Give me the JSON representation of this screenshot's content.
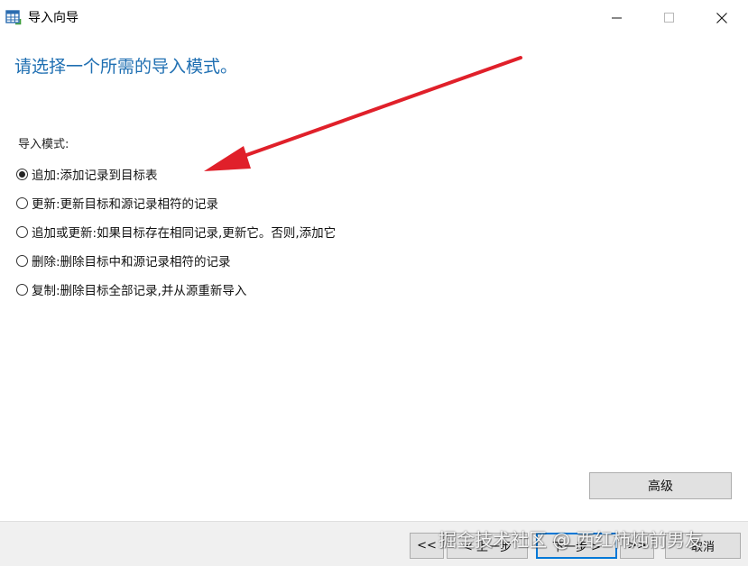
{
  "window": {
    "title": "导入向导",
    "icon": "table-import-icon"
  },
  "heading": "请选择一个所需的导入模式。",
  "mode_group": {
    "label": "导入模式:",
    "options": [
      {
        "label": "追加:添加记录到目标表",
        "checked": true
      },
      {
        "label": "更新:更新目标和源记录相符的记录",
        "checked": false
      },
      {
        "label": "追加或更新:如果目标存在相同记录,更新它。否则,添加它",
        "checked": false
      },
      {
        "label": "删除:删除目标中和源记录相符的记录",
        "checked": false
      },
      {
        "label": "复制:删除目标全部记录,并从源重新导入",
        "checked": false
      }
    ]
  },
  "advanced_button": "高级",
  "footer": {
    "first": "<<",
    "prev": "< 上一步",
    "next": "下一步 >",
    "last": ">>",
    "cancel": "取消"
  },
  "watermark": "掘金技术社区 @ 西红柿炖前男友",
  "colors": {
    "heading": "#1f6fb2",
    "arrow": "#e0202a",
    "accent": "#0078d7"
  }
}
